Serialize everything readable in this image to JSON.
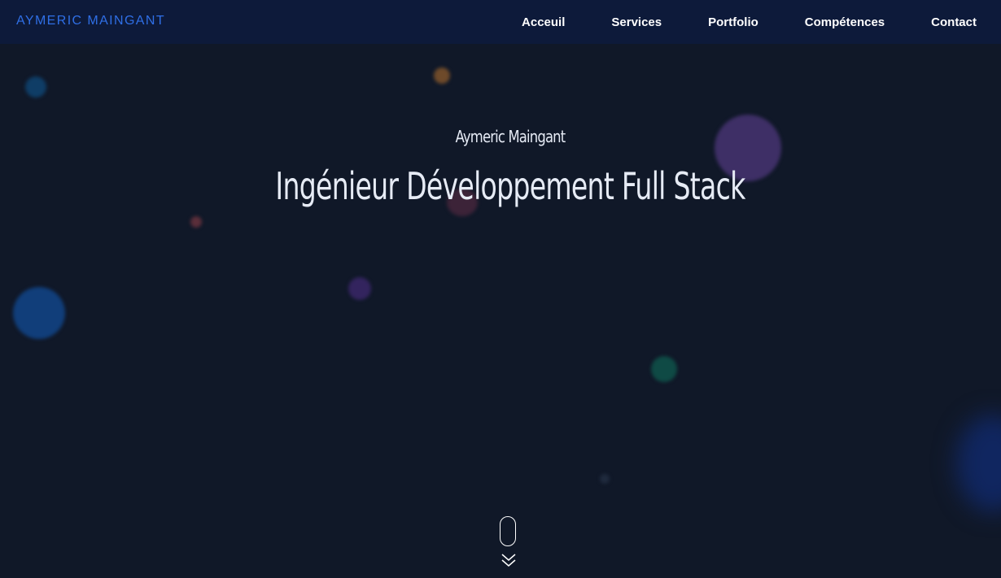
{
  "header": {
    "brand": "AYMERIC MAINGANT",
    "nav": [
      {
        "label": "Acceuil"
      },
      {
        "label": "Services"
      },
      {
        "label": "Portfolio"
      },
      {
        "label": "Compétences"
      },
      {
        "label": "Contact"
      }
    ]
  },
  "hero": {
    "name": "Aymeric Maingant",
    "title": "Ingénieur Développement Full Stack"
  },
  "colors": {
    "background": "#101828",
    "navbar": "#0d1a3a",
    "brand": "#2f6fe6",
    "text": "#e6ebf5"
  },
  "icons": {
    "scroll": "mouse-scroll-icon",
    "down": "double-chevron-down-icon"
  }
}
